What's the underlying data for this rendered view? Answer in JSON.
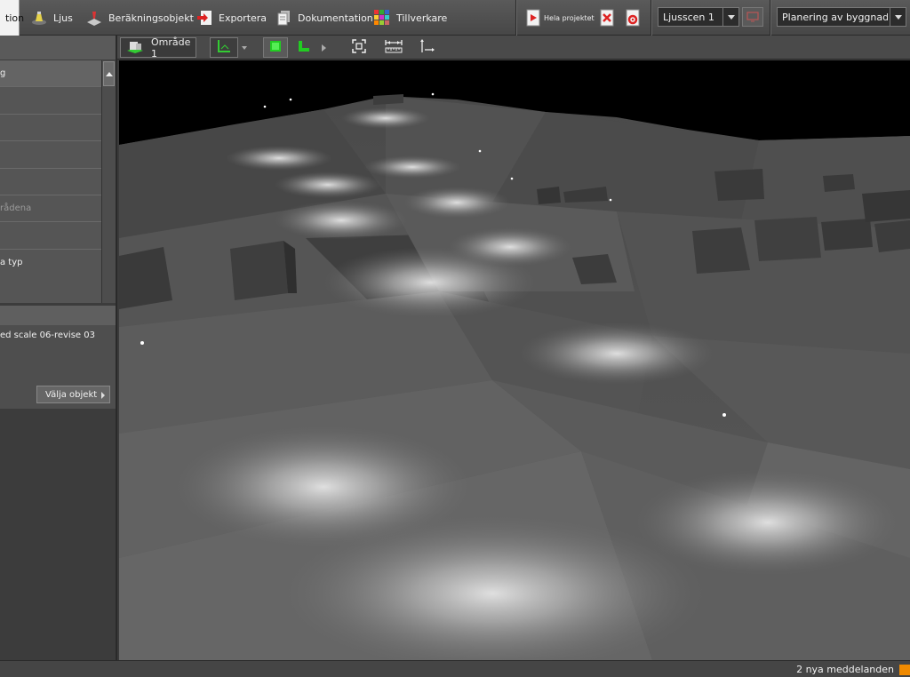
{
  "toolbar": {
    "tabs": [
      {
        "label": "tion",
        "icon": "folder-icon",
        "active": true
      },
      {
        "label": "Ljus",
        "icon": "lamp-icon"
      },
      {
        "label": "Beräkningsobjekt",
        "icon": "calc-object-icon"
      },
      {
        "label": "Exportera",
        "icon": "export-icon"
      },
      {
        "label": "Dokumentation",
        "icon": "documents-icon"
      },
      {
        "label": "Tillverkare",
        "icon": "manufacturer-grid-icon"
      }
    ],
    "project_label": "Hela projektet",
    "light_scene": "Ljusscen 1",
    "planning": "Planering av byggnader..."
  },
  "toolbar2": {
    "area_label": "Område 1"
  },
  "left_panel": {
    "list_items": [
      {
        "label": "g",
        "selected": true
      },
      {
        "label": ""
      },
      {
        "label": ""
      },
      {
        "label": ""
      },
      {
        "label": ""
      },
      {
        "label": "rådena",
        "disabled": true
      },
      {
        "label": ""
      },
      {
        "label": "a typ"
      }
    ],
    "info_text": "ed scale 06-revise 03",
    "select_button": "Välja objekt"
  },
  "status": {
    "messages": "2 nya meddelanden",
    "indicator_color": "#f08a00"
  }
}
